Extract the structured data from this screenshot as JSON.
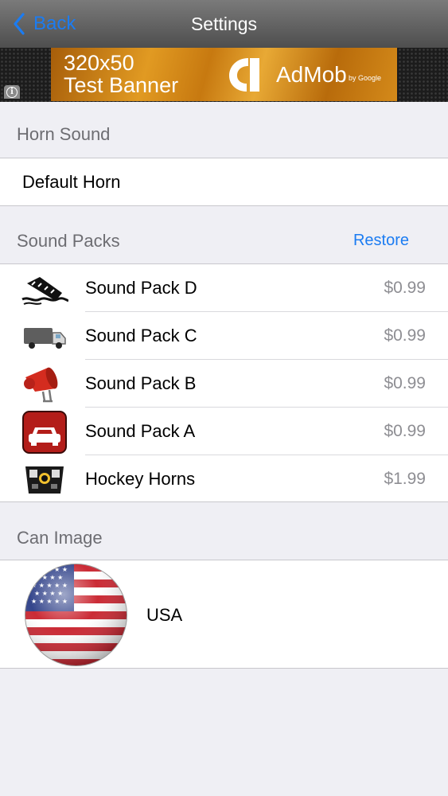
{
  "nav": {
    "back_label": "Back",
    "title": "Settings"
  },
  "ad": {
    "line1": "320x50",
    "line2": "Test Banner",
    "brand": "AdMob",
    "by": "by Google"
  },
  "horn_section": {
    "header": "Horn Sound",
    "selected": "Default Horn"
  },
  "sound_packs": {
    "header": "Sound Packs",
    "restore_label": "Restore",
    "items": [
      {
        "name": "Sound Pack D",
        "price": "$0.99",
        "icon": "sinking-ship-icon"
      },
      {
        "name": "Sound Pack C",
        "price": "$0.99",
        "icon": "truck-icon"
      },
      {
        "name": "Sound Pack B",
        "price": "$0.99",
        "icon": "megaphone-icon"
      },
      {
        "name": "Sound Pack A",
        "price": "$0.99",
        "icon": "car-icon"
      },
      {
        "name": "Hockey Horns",
        "price": "$1.99",
        "icon": "scoreboard-icon"
      }
    ]
  },
  "can_image": {
    "header": "Can Image",
    "selected": "USA",
    "icon": "usa-flag-icon"
  },
  "colors": {
    "accent": "#1b7cf2",
    "background": "#efeff4",
    "secondary_text": "#8e8e93"
  }
}
